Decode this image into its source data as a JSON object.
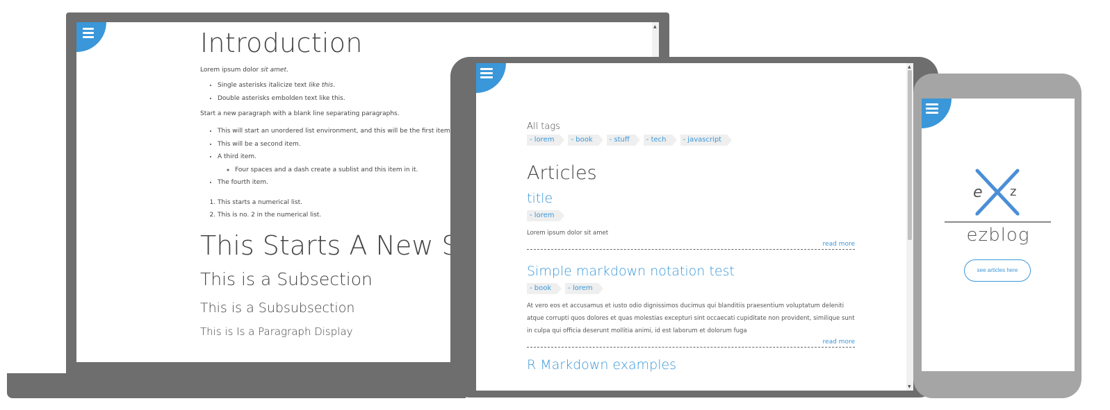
{
  "colors": {
    "accent": "#3a97d9",
    "frame_dark": "#6e6e6e",
    "frame_light": "#a5a5a5"
  },
  "laptop": {
    "menu_icon": "hamburger-menu-icon",
    "doc": {
      "h1": "Introduction",
      "p1_start": "Lorem ipsum dolor ",
      "p1_em": "sit amet",
      "p1_end": ".",
      "ul1": [
        {
          "text": "Single asterisks italicize text ",
          "em": "like this",
          "tail": "."
        },
        {
          "text": "Double asterisks embolden text like this.",
          "em": "",
          "tail": ""
        }
      ],
      "p2": "Start a new paragraph with a blank line separating paragraphs.",
      "ul2": [
        "This will start an unordered list environment, and this will be the first item.",
        "This will be a second item.",
        "A third item."
      ],
      "ul2_sub": "Four spaces and a dash create a sublist and this item in it.",
      "ul2_last": "The fourth item.",
      "ol": [
        "This starts a numerical list.",
        "This is no. 2 in the numerical list."
      ],
      "section": "This Starts A New Se",
      "subsection": "This is a Subsection",
      "subsubsection": "This is a Subsubsection",
      "paragraph_cut": "This is Is a Paragraph Display"
    }
  },
  "tablet": {
    "menu_icon": "hamburger-menu-icon",
    "all_tags_label": "All tags",
    "all_tags": [
      "- lorem",
      "- book",
      "- stuff",
      "- tech",
      "- javascript"
    ],
    "articles_heading": "Articles",
    "articles": [
      {
        "title": "title",
        "tags": [
          "- lorem"
        ],
        "excerpt": "Lorem ipsum dolor sit amet",
        "read_more": "read more"
      },
      {
        "title": "Simple markdown notation test",
        "tags": [
          "- book",
          "- lorem"
        ],
        "excerpt": "At vero eos et accusamus et iusto odio dignissimos ducimus qui blanditiis praesentium voluptatum deleniti atque corrupti quos dolores et quas molestias excepturi sint occaecati cupiditate non provident, similique sunt in culpa qui officia deserunt mollitia animi, id est laborum et dolorum fuga",
        "read_more": "read more"
      }
    ],
    "next_article_cut": "R Markdown examples"
  },
  "phone": {
    "menu_icon": "hamburger-menu-icon",
    "logo_letters": {
      "left": "e",
      "right": "z"
    },
    "logo_text": "ezblog",
    "button_label": "see articles here"
  }
}
